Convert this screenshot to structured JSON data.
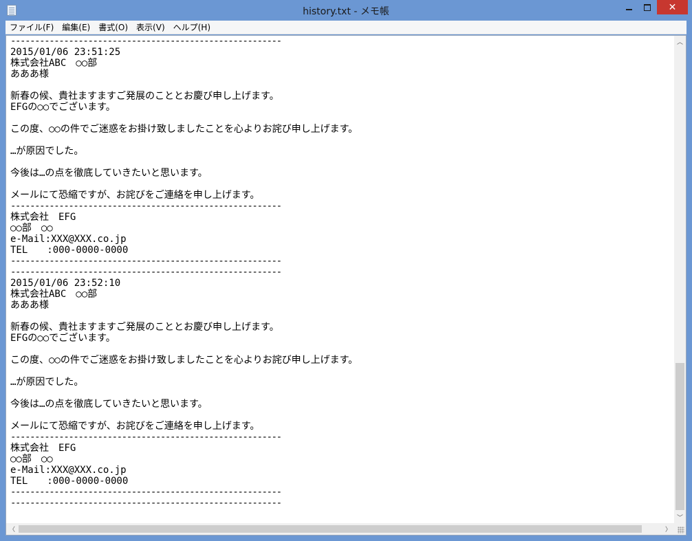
{
  "window": {
    "title": "history.txt - メモ帳",
    "close_glyph": "✕",
    "accent_color": "#6b97d3",
    "close_color": "#c7372f"
  },
  "menu": [
    {
      "name": "menu-file",
      "label": "ファイル(F)"
    },
    {
      "name": "menu-edit",
      "label": "編集(E)"
    },
    {
      "name": "menu-format",
      "label": "書式(O)"
    },
    {
      "name": "menu-view",
      "label": "表示(V)"
    },
    {
      "name": "menu-help",
      "label": "ヘルプ(H)"
    }
  ],
  "document": {
    "lines": [
      "--------------------------------------------------------",
      "2015/01/06 23:51:25",
      "株式会社ABC　○○部",
      "あああ様",
      "",
      "新春の候、貴社ますますご発展のこととお慶び申し上げます。",
      "EFGの○○でございます。",
      "",
      "この度、○○の件でご迷惑をお掛け致しましたことを心よりお詫び申し上げます。",
      "",
      "…が原因でした。",
      "",
      "今後は…の点を徹底していきたいと思います。",
      "",
      "メールにて恐縮ですが、お詫びをご連絡を申し上げます。",
      "--------------------------------------------------------",
      "株式会社　EFG",
      "○○部　○○",
      "e-Mail:XXX@XXX.co.jp",
      "TEL　　:000-0000-0000",
      "--------------------------------------------------------",
      "--------------------------------------------------------",
      "2015/01/06 23:52:10",
      "株式会社ABC　○○部",
      "あああ様",
      "",
      "新春の候、貴社ますますご発展のこととお慶び申し上げます。",
      "EFGの○○でございます。",
      "",
      "この度、○○の件でご迷惑をお掛け致しましたことを心よりお詫び申し上げます。",
      "",
      "…が原因でした。",
      "",
      "今後は…の点を徹底していきたいと思います。",
      "",
      "メールにて恐縮ですが、お詫びをご連絡を申し上げます。",
      "--------------------------------------------------------",
      "株式会社　EFG",
      "○○部　○○",
      "e-Mail:XXX@XXX.co.jp",
      "TEL　　:000-0000-0000",
      "--------------------------------------------------------",
      "--------------------------------------------------------"
    ]
  },
  "scrollbars": {
    "up_glyph": "︿",
    "down_glyph": "﹀",
    "left_glyph": "〈",
    "right_glyph": "〉"
  }
}
